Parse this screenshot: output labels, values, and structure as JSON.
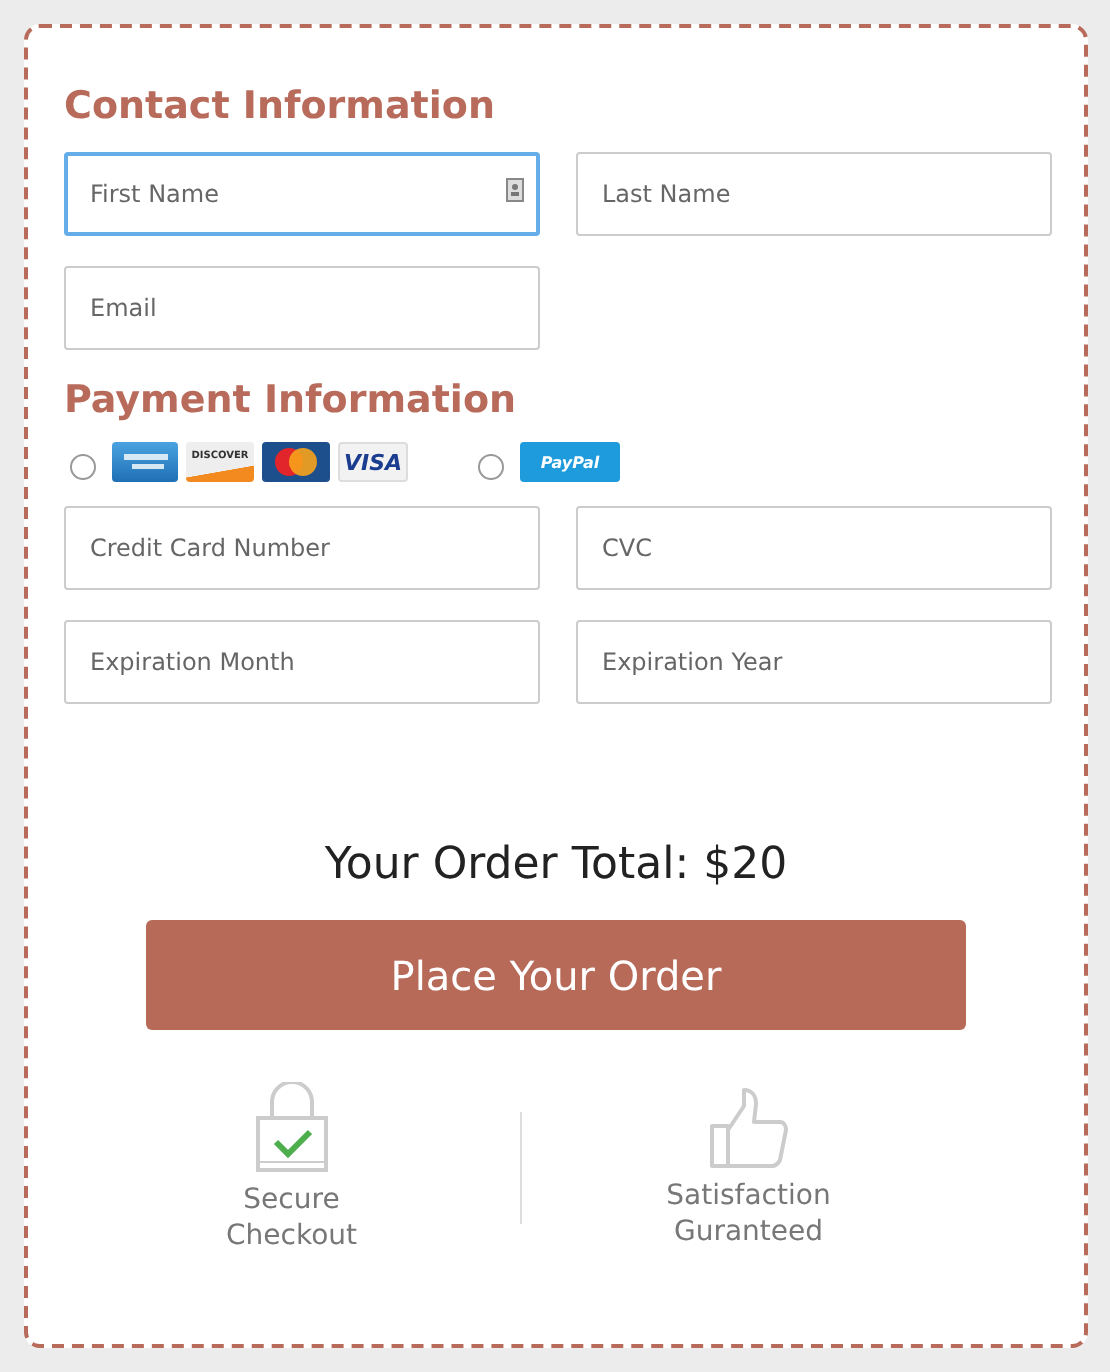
{
  "contact": {
    "title": "Contact Information",
    "fields": [
      {
        "placeholder": "First Name",
        "focused": true
      },
      {
        "placeholder": "Last Name",
        "focused": false
      },
      {
        "placeholder": "Email",
        "focused": false
      }
    ]
  },
  "payment": {
    "title": "Payment Information",
    "methods": [
      {
        "kind": "cards",
        "selected": false,
        "logos": [
          "DISCOVER",
          "VISA"
        ]
      },
      {
        "kind": "paypal",
        "selected": false,
        "logos": [
          "PayPal"
        ]
      }
    ],
    "fields": [
      {
        "placeholder": "Credit Card Number",
        "focused": false
      },
      {
        "placeholder": "CVC",
        "focused": false
      },
      {
        "placeholder": "Expiration Month",
        "focused": false
      },
      {
        "placeholder": "Expiration Year",
        "focused": false
      }
    ]
  },
  "order_total": "Your Order Total: $20",
  "submit_button": "Place Your Order",
  "features": [
    {
      "kind": "secure",
      "label": "Secure Checkout"
    },
    {
      "kind": "satisfaction",
      "label": "Satisfaction Guranteed"
    }
  ]
}
